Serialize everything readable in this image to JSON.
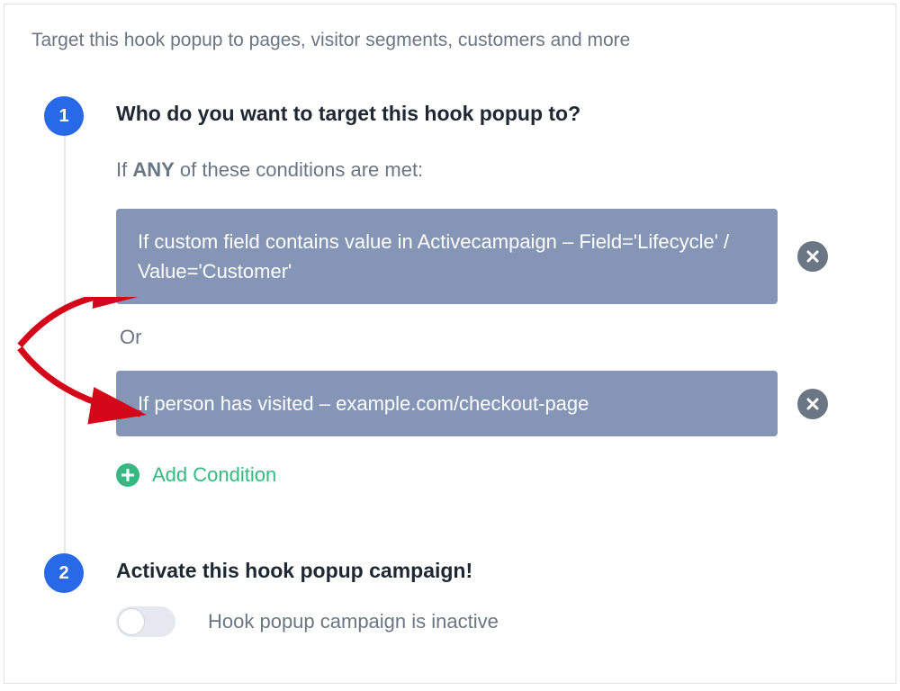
{
  "intro": "Target this hook popup to pages, visitor segments, customers and more",
  "step1": {
    "number": "1",
    "title": "Who do you want to target this hook popup to?",
    "conditions_intro_prefix": "If ",
    "conditions_intro_emph": "ANY",
    "conditions_intro_suffix": " of these conditions are met:",
    "conditions": [
      "If custom field contains value in Activecampaign – Field='Lifecycle' / Value='Customer'",
      "If person has visited – example.com/checkout-page"
    ],
    "or_label": "Or",
    "add_condition_label": "Add Condition"
  },
  "step2": {
    "number": "2",
    "title": "Activate this hook popup campaign!",
    "toggle_label": "Hook popup campaign is inactive"
  }
}
